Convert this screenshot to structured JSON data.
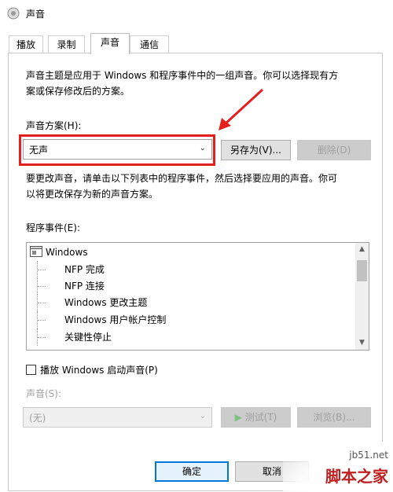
{
  "window": {
    "title": "声音",
    "icon": "speaker-icon"
  },
  "tabs": [
    {
      "label": "播放",
      "active": false
    },
    {
      "label": "录制",
      "active": false
    },
    {
      "label": "声音",
      "active": true
    },
    {
      "label": "通信",
      "active": false
    }
  ],
  "description": {
    "line1": "声音主题是应用于 Windows 和程序事件中的一组声音。你可以选择现有方",
    "line2": "案或保存修改后的方案。"
  },
  "scheme": {
    "label": "声音方案(H):",
    "selected": "无声",
    "save_as_button": "另存为(V)...",
    "delete_button": "删除(D)"
  },
  "instructions": {
    "line1": "要更改声音，请单击以下列表中的程序事件，然后选择要应用的声音。你可",
    "line2": "以将更改保存为新的声音方案。"
  },
  "events": {
    "label": "程序事件(E):",
    "root": "Windows",
    "items": [
      "NFP 完成",
      "NFP 连接",
      "Windows 更改主题",
      "Windows 用户帐户控制",
      "关键性停止"
    ]
  },
  "startup": {
    "label": "播放 Windows 启动声音(P)",
    "checked": false
  },
  "sound": {
    "label": "声音(S):",
    "selected": "(无)",
    "test_button": "测试(T)",
    "browse_button": "浏览(B)..."
  },
  "footer": {
    "ok_button": "确定",
    "cancel_button": "取消"
  },
  "watermark": {
    "site": "jb51.net",
    "brand": "脚本之家"
  },
  "colors": {
    "highlight_box": "#e51e1e",
    "focus_blue": "#0078d7",
    "disabled_text": "#a0a0a0"
  }
}
